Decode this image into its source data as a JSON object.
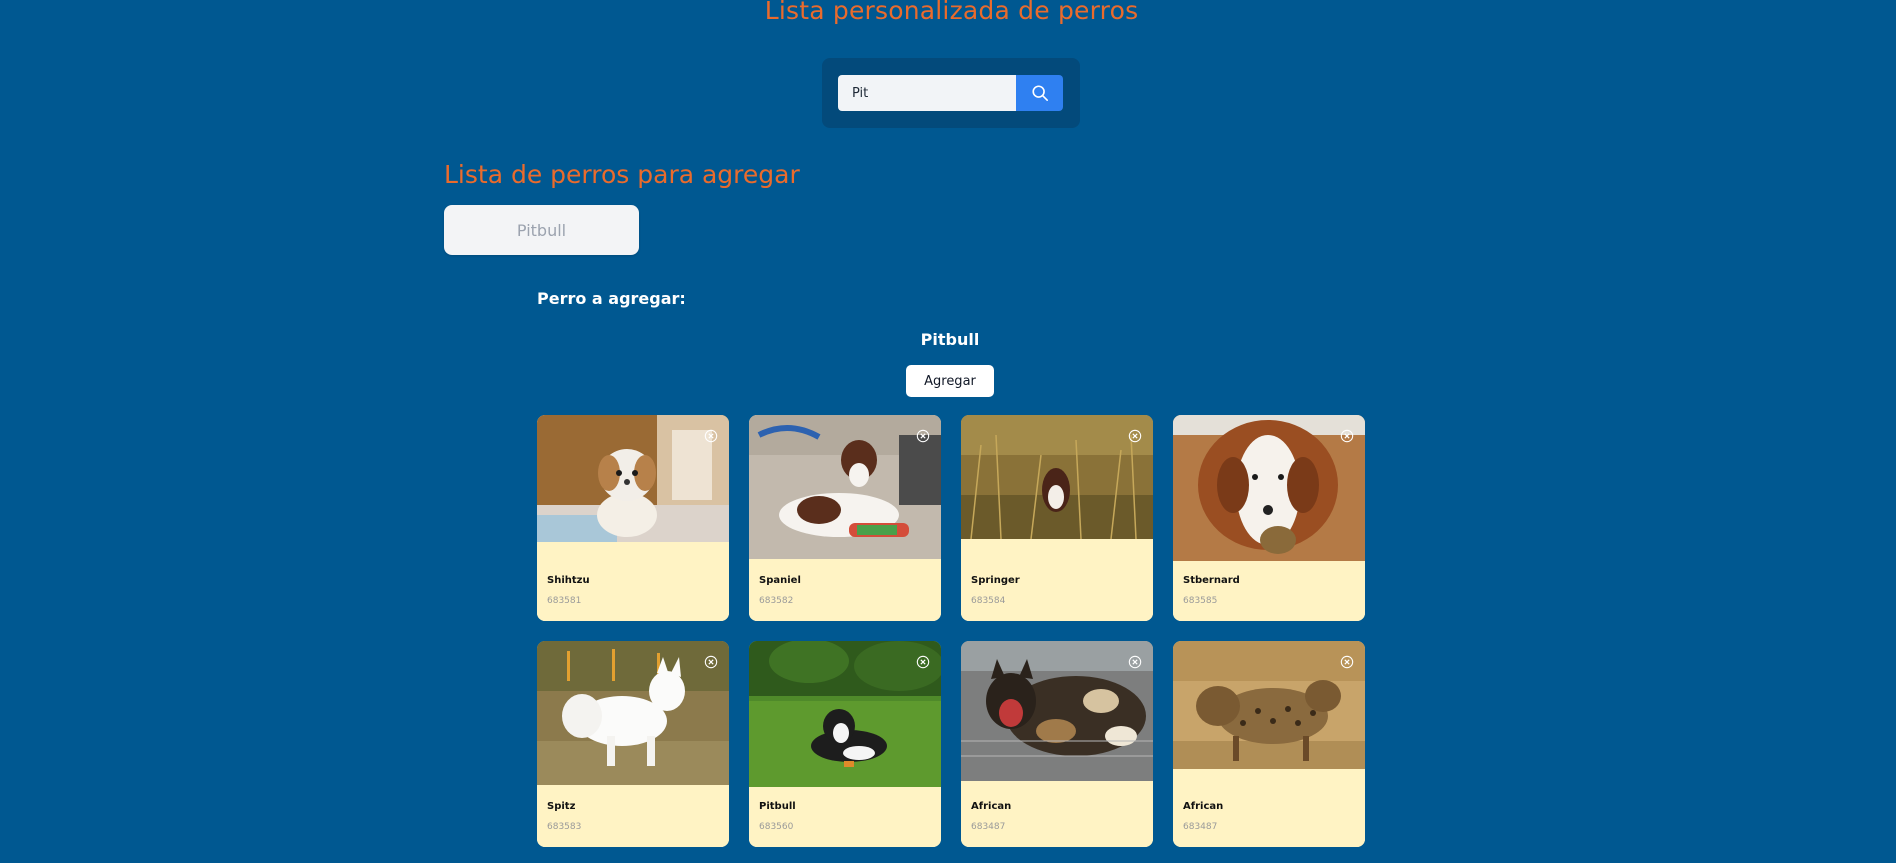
{
  "header": {
    "title": "Lista personalizada de perros"
  },
  "search": {
    "value": "Pit",
    "icon": "search-icon"
  },
  "candidates": {
    "title": "Lista de perros para agregar",
    "items": [
      "Pitbull"
    ]
  },
  "selection": {
    "label": "Perro a agregar:",
    "name": "Pitbull",
    "add_label": "Agregar"
  },
  "dogs": [
    {
      "name": "Shihtzu",
      "id": "683581",
      "photo": "shihtzu-puppy-photo"
    },
    {
      "name": "Spaniel",
      "id": "683582",
      "photo": "spaniel-puppy-photo"
    },
    {
      "name": "Springer",
      "id": "683584",
      "photo": "springer-in-grass-photo"
    },
    {
      "name": "Stbernard",
      "id": "683585",
      "photo": "st-bernard-puppy-photo"
    },
    {
      "name": "Spitz",
      "id": "683583",
      "photo": "white-spitz-photo"
    },
    {
      "name": "Pitbull",
      "id": "683560",
      "photo": "dog-on-lawn-photo"
    },
    {
      "name": "African",
      "id": "683487",
      "photo": "african-wild-dog-photo"
    },
    {
      "name": "African",
      "id": "683487",
      "photo": "hyena-photo"
    }
  ],
  "colors": {
    "background": "#005891",
    "accent": "#ea6b2c",
    "card": "#fff3c4",
    "search_button": "#2f80f1"
  }
}
